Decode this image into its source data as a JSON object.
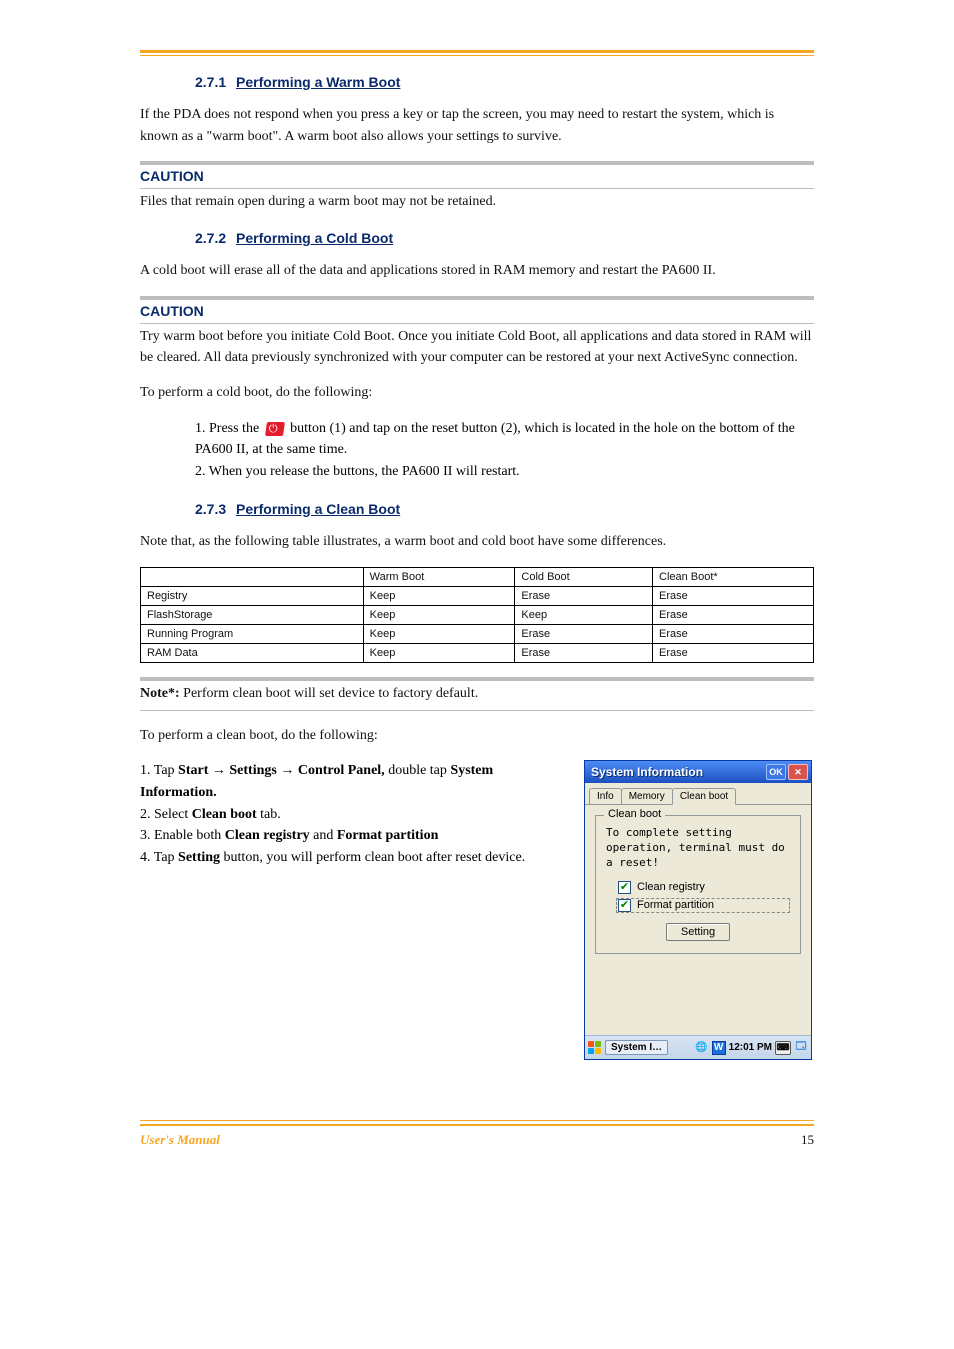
{
  "sections": {
    "s1": {
      "num": "2.7.1",
      "title": "Performing a Warm Boot"
    },
    "s2": {
      "num": "2.7.2",
      "title": "Performing a Cold Boot"
    },
    "s3": {
      "num": "2.7.3",
      "title": "Performing a Clean Boot"
    }
  },
  "p1": "If the PDA does not respond when you press a key or tap the screen, you may need to restart the system, which is known as a \"warm boot\". A warm boot also allows your settings to survive.",
  "caution1_label": "CAUTION",
  "caution1_text": "Files that remain open during a warm boot may not be retained.",
  "p2": "A cold boot will erase all of the data and applications stored in RAM memory and restart the PA600 II.",
  "caution2_label": "CAUTION",
  "caution2_text": "Try warm boot before you initiate Cold Boot. Once you initiate Cold Boot, all applications and data stored in RAM will be cleared. All data previously synchronized with your computer can be restored at your next ActiveSync connection.",
  "cold_steps_lead": "To perform a cold boot, do the following:",
  "cold_step1_pre": "1.  Press the ",
  "cold_step1_post": " button (1) and tap on the reset button (2), which is located in the hole on the bottom of the PA600 II, at the same time.",
  "cold_step2": "2.  When you release the buttons, the PA600 II will restart.",
  "note_text": "Note that, as the following table illustrates, a warm boot and cold boot have some differences.",
  "table": {
    "headers": [
      "",
      "Warm Boot",
      "Cold Boot",
      "Clean Boot*"
    ],
    "rows": [
      [
        "Registry",
        "Keep",
        "Erase",
        "Erase"
      ],
      [
        "FlashStorage",
        "Keep",
        "Keep",
        "Erase"
      ],
      [
        "Running Program",
        "Keep",
        "Erase",
        "Erase"
      ],
      [
        "RAM Data",
        "Keep",
        "Erase",
        "Erase"
      ]
    ]
  },
  "clean_note_lead": "Note*:",
  "clean_note_text": " Perform clean boot will set device to factory default.",
  "clean_steps_lead": "To perform a clean boot, do the following:",
  "clean_step1_a": "1.  Tap ",
  "clean_step1_b": "Start ",
  "clean_step1_c": " Settings ",
  "clean_step1_d": " Control Panel, ",
  "clean_step1_e": "double tap ",
  "clean_step1_f": "System Information.",
  "clean_step2_a": "2.  Select ",
  "clean_step2_b": "Clean boot ",
  "clean_step2_c": "tab.",
  "clean_step3_a": "3.  Enable both ",
  "clean_step3_b": "Clean registry ",
  "clean_step3_c": "and ",
  "clean_step3_d": "Format partition",
  "clean_step4_a": "4.  Tap ",
  "clean_step4_b": "Setting ",
  "clean_step4_c": "button, you will perform clean boot after reset device.",
  "window": {
    "title": "System Information",
    "ok": "OK",
    "tabs": [
      "Info",
      "Memory",
      "Clean boot"
    ],
    "group_title": "Clean boot",
    "group_text": "To complete setting operation, terminal must do a reset!",
    "chk1": "Clean registry",
    "chk2": "Format partition",
    "btn": "Setting",
    "taskbtn": "System I…",
    "time": "12:01 PM"
  },
  "footer_left": "User's Manual",
  "footer_right": "15"
}
